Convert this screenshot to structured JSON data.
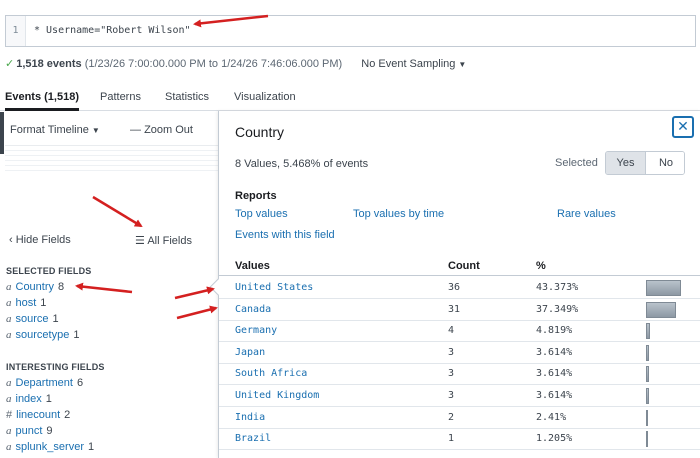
{
  "search": {
    "line_number": "1",
    "query": "* Username=\"Robert Wilson\""
  },
  "status": {
    "event_count": "1,518 events",
    "range": "(1/23/26 7:00:00.000 PM to 1/24/26 7:46:06.000 PM)",
    "sampling": "No Event Sampling",
    "check_icon": "check-icon",
    "success_color": "#4aa84d"
  },
  "tabs": [
    {
      "label": "Events (1,518)",
      "active": true
    },
    {
      "label": "Patterns",
      "active": false
    },
    {
      "label": "Statistics",
      "active": false
    },
    {
      "label": "Visualization",
      "active": false
    }
  ],
  "timeline": {
    "format_label": "Format Timeline",
    "zoom_label": "Zoom Out"
  },
  "fields_panel": {
    "hide_label": "Hide Fields",
    "all_label": "All Fields",
    "selected_header": "SELECTED FIELDS",
    "selected": [
      {
        "type": "a",
        "name": "Country",
        "count": "8"
      },
      {
        "type": "a",
        "name": "host",
        "count": "1"
      },
      {
        "type": "a",
        "name": "source",
        "count": "1"
      },
      {
        "type": "a",
        "name": "sourcetype",
        "count": "1"
      }
    ],
    "interesting_header": "INTERESTING FIELDS",
    "interesting": [
      {
        "type": "a",
        "name": "Department",
        "count": "6"
      },
      {
        "type": "a",
        "name": "index",
        "count": "1"
      },
      {
        "type": "#",
        "name": "linecount",
        "count": "2"
      },
      {
        "type": "a",
        "name": "punct",
        "count": "9"
      },
      {
        "type": "a",
        "name": "splunk_server",
        "count": "1"
      }
    ]
  },
  "popup": {
    "title": "Country",
    "close_icon": "close-icon",
    "summary": "8 Values, 5.468% of events",
    "selected_label": "Selected",
    "yes_label": "Yes",
    "no_label": "No",
    "selected_value": "Yes",
    "reports_header": "Reports",
    "reports": [
      "Top values",
      "Top values by time",
      "Rare values",
      "Events with this field"
    ],
    "columns": [
      "Values",
      "Count",
      "%"
    ],
    "rows": [
      {
        "value": "United States",
        "count": "36",
        "pct": "43.373%",
        "fraction": 0.43373
      },
      {
        "value": "Canada",
        "count": "31",
        "pct": "37.349%",
        "fraction": 0.37349
      },
      {
        "value": "Germany",
        "count": "4",
        "pct": "4.819%",
        "fraction": 0.04819
      },
      {
        "value": "Japan",
        "count": "3",
        "pct": "3.614%",
        "fraction": 0.03614
      },
      {
        "value": "South Africa",
        "count": "3",
        "pct": "3.614%",
        "fraction": 0.03614
      },
      {
        "value": "United Kingdom",
        "count": "3",
        "pct": "3.614%",
        "fraction": 0.03614
      },
      {
        "value": "India",
        "count": "2",
        "pct": "2.41%",
        "fraction": 0.0241
      },
      {
        "value": "Brazil",
        "count": "1",
        "pct": "1.205%",
        "fraction": 0.01205
      }
    ]
  },
  "colors": {
    "link": "#1a6fb0",
    "annotation_arrow": "#d42020"
  }
}
